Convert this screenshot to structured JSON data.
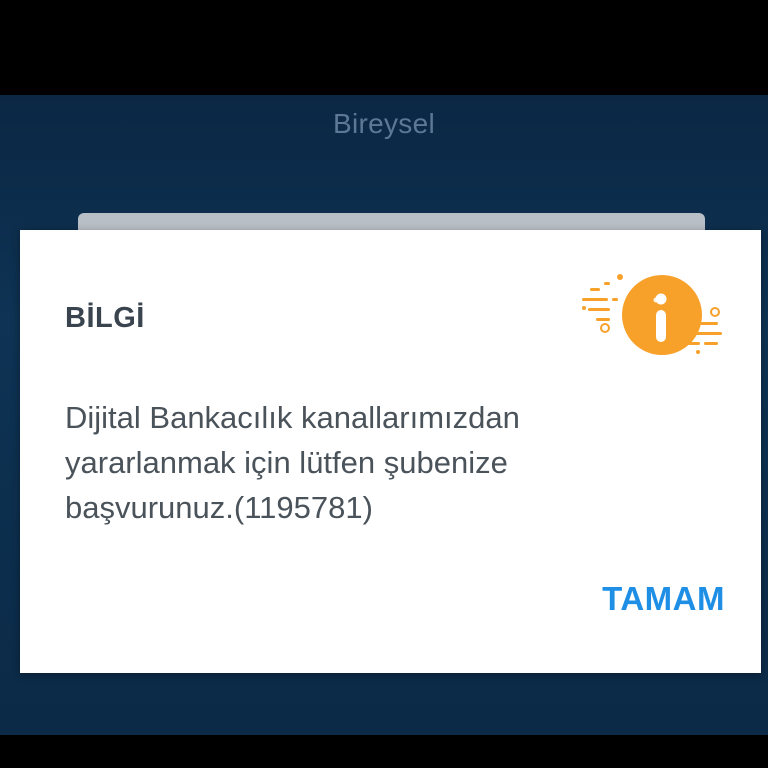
{
  "app": {
    "title": "Bireysel"
  },
  "dialog": {
    "title": "BİLGİ",
    "message": "Dijital Bankacılık kanallarımızdan yararlanmak için lütfen şubenize başvurunuz.(1195781)",
    "ok_label": "TAMAM",
    "icon": "info-icon"
  },
  "colors": {
    "accent_blue": "#1f8fe6",
    "icon_orange": "#f7a12b",
    "app_background": "#0e3354"
  }
}
